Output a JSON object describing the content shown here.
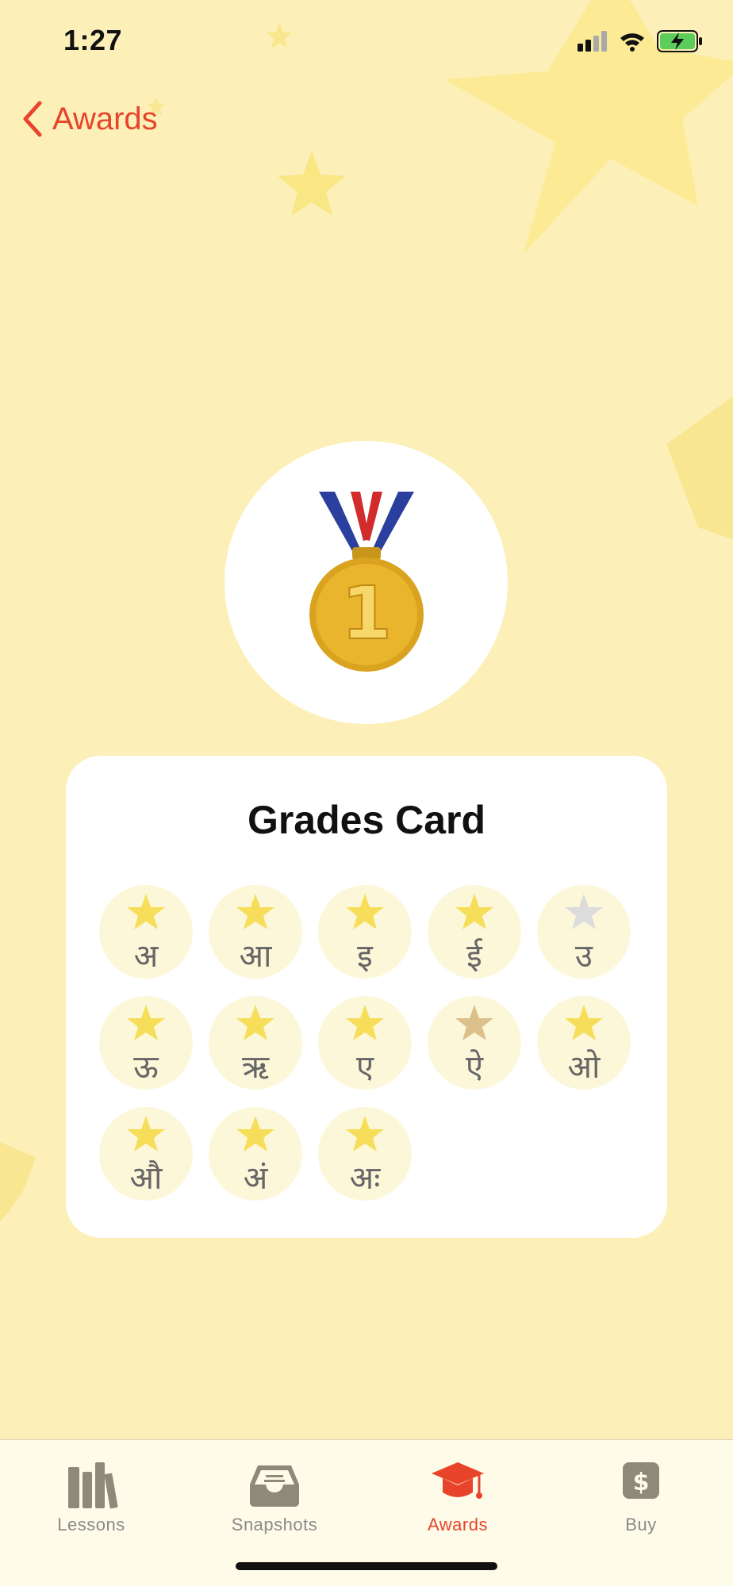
{
  "status_bar": {
    "time": "1:27"
  },
  "nav": {
    "back_label": "Awards"
  },
  "medal": {
    "icon": "gold-medal-icon",
    "digit": "1"
  },
  "card": {
    "title": "Grades Card",
    "items": [
      {
        "letter": "अ",
        "star": "gold"
      },
      {
        "letter": "आ",
        "star": "gold"
      },
      {
        "letter": "इ",
        "star": "gold"
      },
      {
        "letter": "ई",
        "star": "gold"
      },
      {
        "letter": "उ",
        "star": "silver"
      },
      {
        "letter": "ऊ",
        "star": "gold"
      },
      {
        "letter": "ऋ",
        "star": "gold"
      },
      {
        "letter": "ए",
        "star": "gold"
      },
      {
        "letter": "ऐ",
        "star": "bronze"
      },
      {
        "letter": "ओ",
        "star": "gold"
      },
      {
        "letter": "औ",
        "star": "gold"
      },
      {
        "letter": "अं",
        "star": "gold"
      },
      {
        "letter": "अः",
        "star": "gold"
      }
    ]
  },
  "star_colors": {
    "gold": "#f6de5a",
    "silver": "#dcdcdc",
    "bronze": "#dcc08a"
  },
  "tabs": [
    {
      "label": "Lessons",
      "icon": "books-icon",
      "active": false
    },
    {
      "label": "Snapshots",
      "icon": "inbox-tray-icon",
      "active": false
    },
    {
      "label": "Awards",
      "icon": "graduation-cap-icon",
      "active": true
    },
    {
      "label": "Buy",
      "icon": "dollar-sign-icon",
      "active": false
    }
  ],
  "colors": {
    "accent": "#e8442c",
    "background": "#fcf0b8",
    "inactive_tab": "#8a8a8a"
  }
}
